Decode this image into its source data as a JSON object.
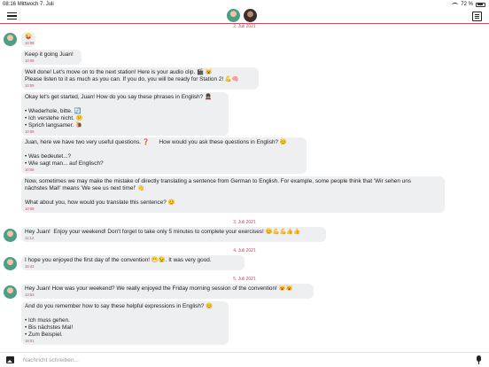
{
  "status_bar": {
    "time": "08:16",
    "date": "Mittwoch 7. Juli",
    "battery": "72 %",
    "battery_level_percent": 72
  },
  "header": {
    "coach_avatar": "coach-avatar",
    "user_avatar": "user-avatar",
    "menu_icon": "menu-icon",
    "right_icon": "book-icon"
  },
  "chat": {
    "dates": [
      "2. Juli 2021",
      "3. Juli 2021",
      "4. Juli 2021",
      "5. Juli 2021"
    ],
    "messages": [
      {
        "lines": [
          "😜"
        ],
        "time": "10:08"
      },
      {
        "lines": [
          "Keep it going Juan!"
        ],
        "time": "10:09"
      },
      {
        "lines": [
          "Well done! Let's move on to the next station! Here is your audio clip. 🎬 😺",
          "Please listen to it as much as you can. If you do, you will be ready for Station 2! 💪🧠"
        ],
        "time": "10:09"
      },
      {
        "lines": [
          "Okay let's get started, Juan! How do you say these phrases in English? 💂",
          "",
          "• Wiederhole, bitte. 🔄",
          "• Ich verstehe nicht. 😕",
          "• Sprich langsamer. 🐌"
        ],
        "time": "10:09"
      },
      {
        "lines": [
          "Juan, here we have two very useful questions. ❓      How would you ask these questions in English? 😊",
          "",
          "• Was bedeutet...?",
          "• Wie sagt man... auf Englisch?"
        ],
        "time": "10:09"
      },
      {
        "lines": [
          "Now, sometimes we may make the mistake of directly translating a sentence from German to English. For example, some people think that 'Wir sehen uns",
          "nächstes Mal!' means 'We see us next time!' 👋",
          "",
          "What about you, how would you translate this sentence? 😊"
        ],
        "time": "10:09"
      },
      {
        "lines": [
          "Hey Juan!  Enjoy your weekend! Don't forget to take only 5 minutes to complete your exercises! 😊💪💪👍👍"
        ],
        "time": "11:12"
      },
      {
        "lines": [
          "I hope you enjoyed the first day of the convention! 😁😉. It was very good."
        ],
        "time": "18:43"
      },
      {
        "lines": [
          "Hey Juan! How was your weekend? We really enjoyed the Friday morning session of the convention! 😺😺"
        ],
        "time": "13:53"
      },
      {
        "lines": [
          "And do you remember how to say these helpful expressions in English? 😊",
          "",
          "• Ich muss gehen.",
          "• Bis nächstes Mal!",
          "• Zum Beispiel."
        ],
        "time": "18:01"
      }
    ]
  },
  "composer": {
    "placeholder": "Nachricht schreiben...",
    "value": ""
  }
}
